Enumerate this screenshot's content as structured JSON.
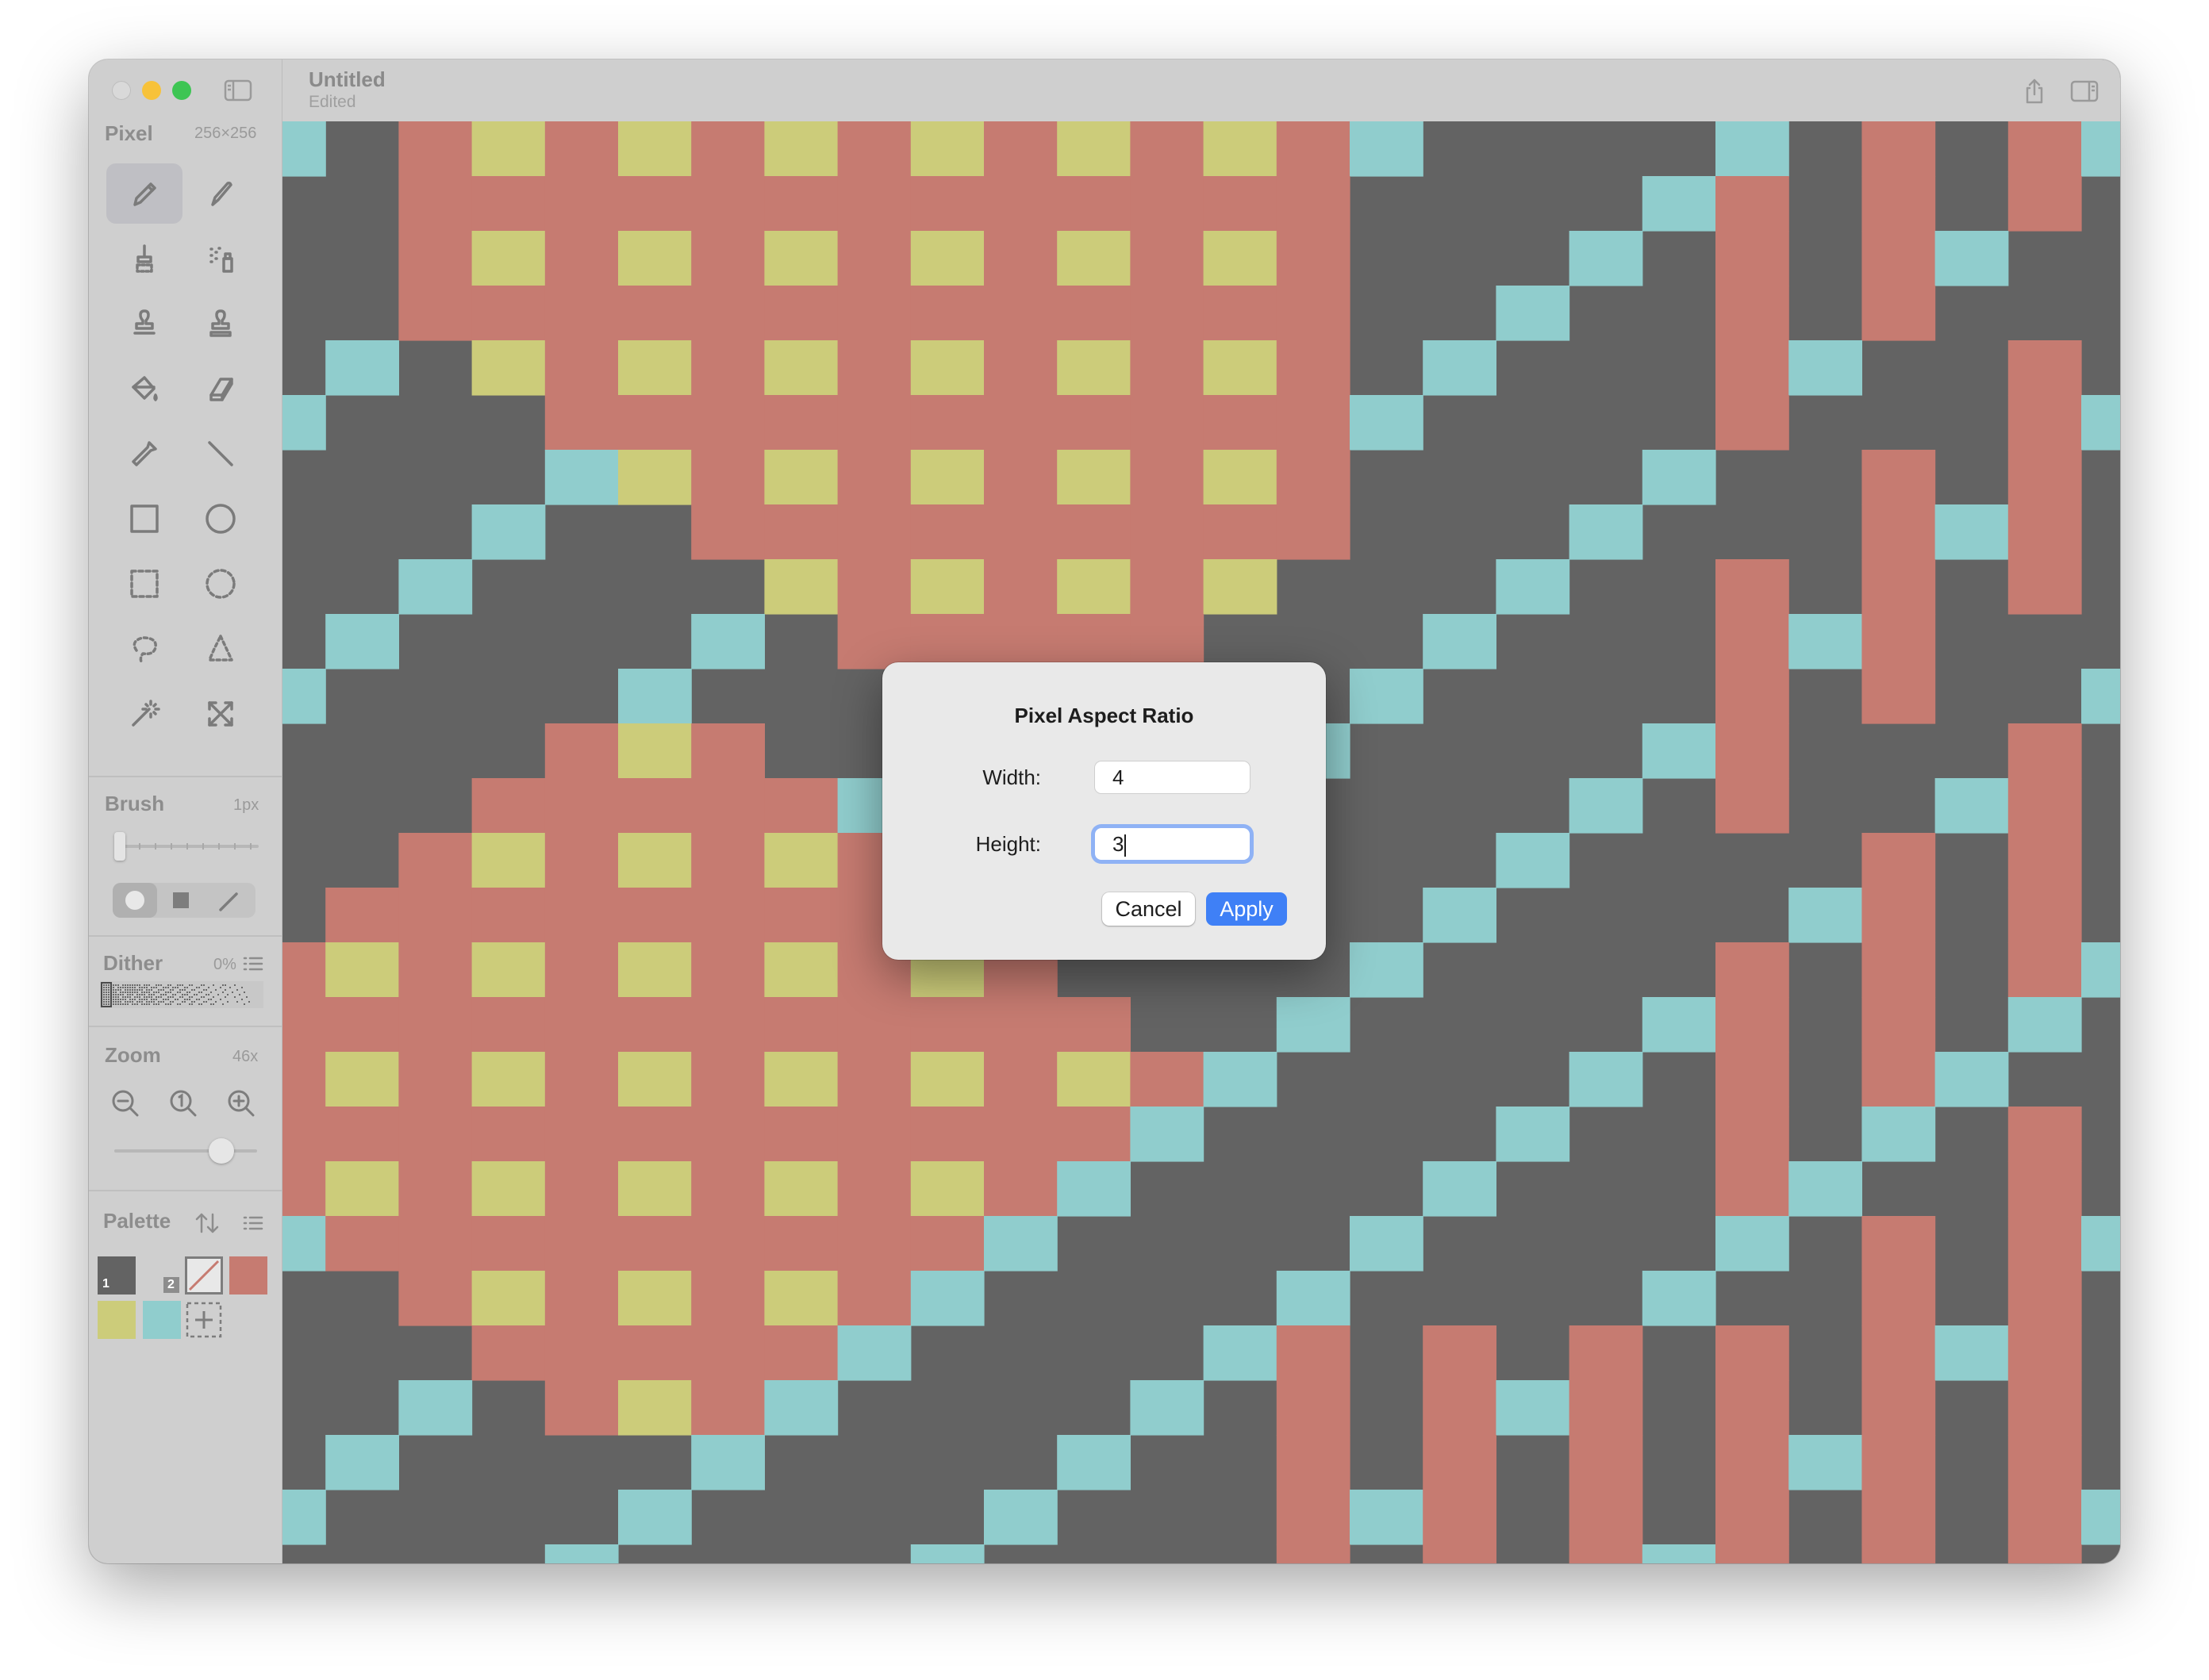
{
  "window": {
    "title": "Untitled",
    "subtitle": "Edited"
  },
  "sidebar": {
    "pixel_label": "Pixel",
    "canvas_size": "256×256",
    "brush_label": "Brush",
    "brush_size": "1px",
    "dither_label": "Dither",
    "dither_value": "0%",
    "zoom_label": "Zoom",
    "zoom_value": "46x",
    "palette_label": "Palette",
    "tools": [
      "pencil",
      "pen",
      "dither-brush",
      "spray",
      "stamp-a",
      "stamp-b",
      "paint-bucket",
      "eraser",
      "eyedropper",
      "line",
      "rectangle",
      "ellipse",
      "rect-select",
      "ellipse-select",
      "lasso-select",
      "polygon-select",
      "magic-wand",
      "transform"
    ],
    "palette": {
      "primary_index": "1",
      "secondary_index": "2",
      "colors": [
        "#636363",
        "#c67b71",
        "#cccc7a",
        "#90cdcd"
      ]
    }
  },
  "canvas": {
    "colors": {
      "bg": "#636363",
      "red": "#c67b71",
      "yellow": "#cccc7a",
      "cyan": "#90cdcd"
    }
  },
  "dialog": {
    "title": "Pixel Aspect Ratio",
    "width_label": "Width:",
    "width_value": "4",
    "height_label": "Height:",
    "height_value": "3",
    "cancel_label": "Cancel",
    "apply_label": "Apply"
  }
}
